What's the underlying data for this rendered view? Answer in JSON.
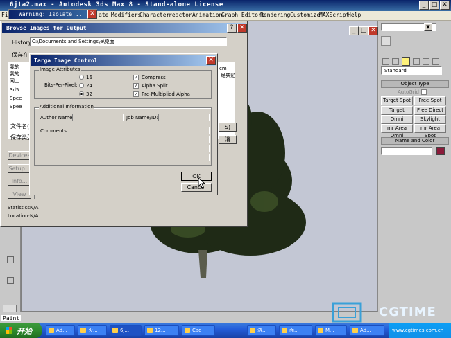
{
  "max_window": {
    "title": "6jta2.max - Autodesk 3ds Max 8 - Stand-alone License",
    "menus": [
      "Fi",
      "ate",
      "Modifiers",
      "Character",
      "reactor",
      "Animation",
      "Graph Editors",
      "Rendering",
      "Customize",
      "MAXScript",
      "Help"
    ],
    "status_paint": "Paint"
  },
  "warning_tab": {
    "title": "Warning: Isolate..."
  },
  "command_panel": {
    "dropdown_value": "Standard",
    "rollout_object_type": "Object Type",
    "autogrid": "AutoGrid",
    "buttons": [
      "Target Spot",
      "Free Spot",
      "Target Direct",
      "Free Direct",
      "Omni",
      "Skylight",
      "mr Area Omni",
      "mr Area Spot"
    ],
    "rollout_name_color": "Name and Color",
    "accent_color": "#8b1a3a"
  },
  "browse_dialog": {
    "title": "Browse Images for Output",
    "history_label": "History:",
    "history_value": "C:\\Documents and Settings\\e\\桌面",
    "save_in_label": "保存在",
    "file_items": [
      "我的",
      "我的",
      "网上",
      "3d5",
      "Spee",
      "Spee"
    ],
    "extra_text": "cm",
    "extra_text_2": "·经典贴",
    "file_name_label": "文件名(",
    "file_type_label": "保存类型",
    "save_button": "S)",
    "cancel_button": "消",
    "devices_button": "Devices",
    "setup_button": "Setup...",
    "info_button": "Info...",
    "view_button": "View",
    "statistics_label": "Statistics:",
    "statistics_value": "N/A",
    "location_label": "Location:",
    "location_value": "N/A"
  },
  "targa_dialog": {
    "title": "Targa Image Control",
    "image_attributes_label": "Image Attributes",
    "bits_per_pixel_label": "Bits-Per-Pixel:",
    "bits_options": [
      "16",
      "24",
      "32"
    ],
    "selected_bits": "32",
    "compress_label": "Compress",
    "alpha_split_label": "Alpha Split",
    "premultiplied_label": "Pre-Multiplied Alpha",
    "additional_info_label": "Additional Information",
    "author_name_label": "Author Name:",
    "author_name_value": "",
    "job_name_label": "Job Name/ID:",
    "job_name_value": "",
    "comments_label": "Comments:",
    "ok_button": "OK",
    "cancel_button": "Cancel"
  },
  "taskbar": {
    "start_label": "开始",
    "tasks": [
      "Ad...",
      "火...",
      "6j...",
      "12...",
      "Cad",
      "游...",
      "面...",
      "M...",
      "Ad..."
    ],
    "tray_text": "www.cgtimes.com.cn"
  },
  "watermark": {
    "text": "CGTIME",
    "url": "www.cgtimes.com.cn"
  }
}
